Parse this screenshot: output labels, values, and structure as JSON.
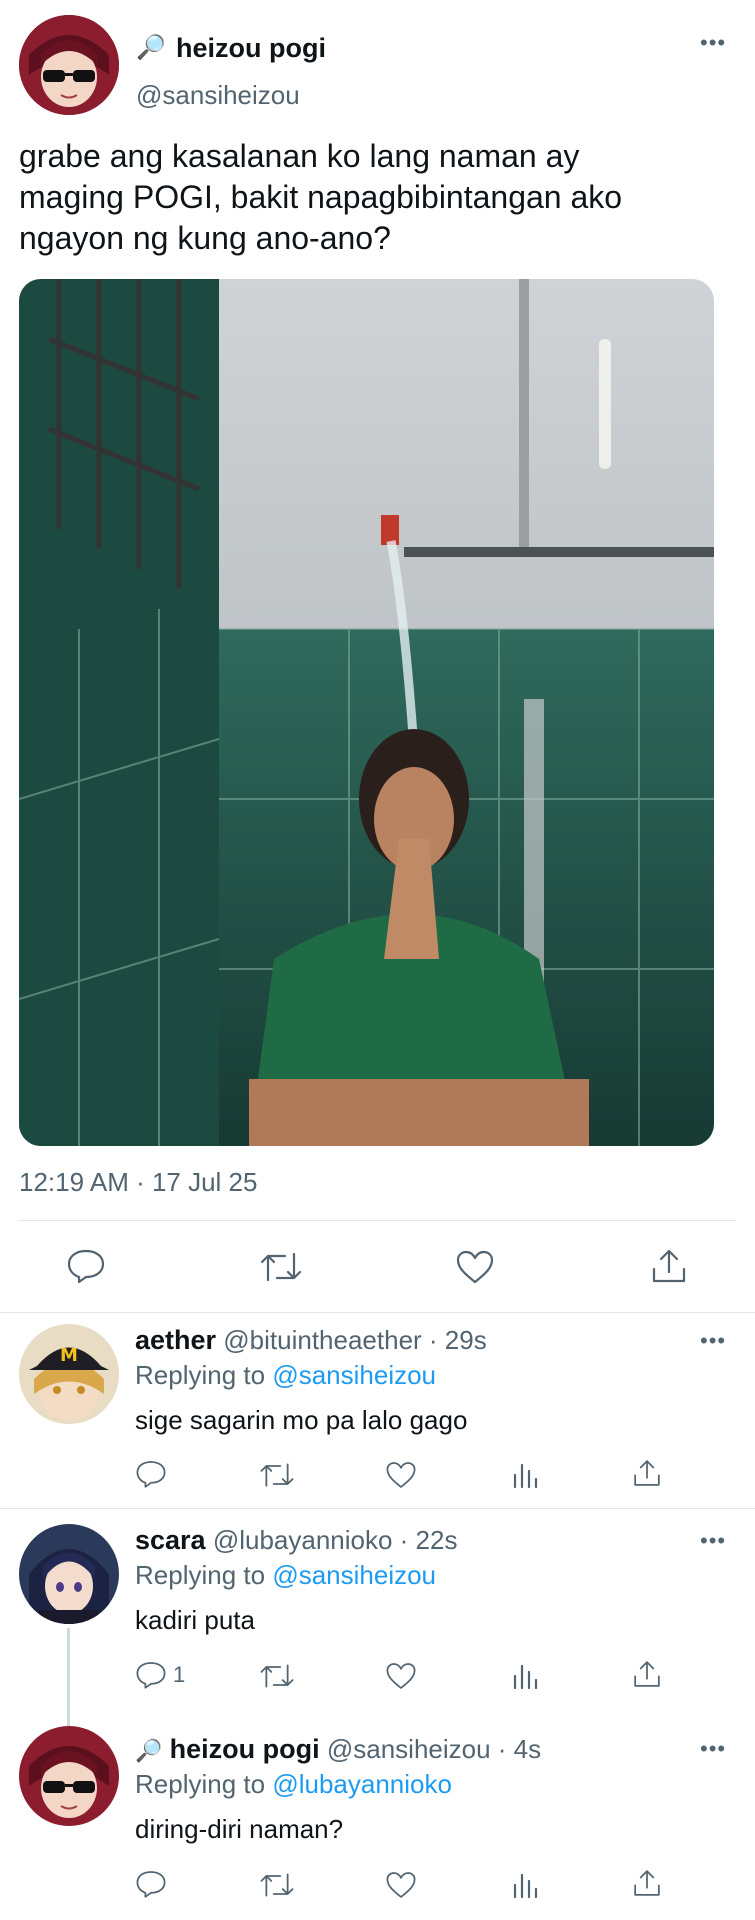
{
  "main_tweet": {
    "emoji": "🔎",
    "name": "heizou pogi",
    "handle": "@sansiheizou",
    "text_line1": "grabe ang kasalanan ko lang naman ay",
    "text_line2": "maging POGI, bakit napagbibintangan ako",
    "text_line3": "ngayon ng kung ano-ano?",
    "timestamp": "12:19 AM · 17 Jul 25",
    "more_label": "•••"
  },
  "replies": [
    {
      "name": "aether",
      "handle_time": "@bituintheaether · 29s",
      "replying_prefix": "Replying to",
      "replying_to": "@sansiheizou",
      "text": "sige sagarin mo pa lalo gago",
      "reply_count": ""
    },
    {
      "name": "scara",
      "handle_time": "@lubayannioko · 22s",
      "replying_prefix": "Replying to",
      "replying_to": "@sansiheizou",
      "text": "kadiri puta",
      "reply_count": "1"
    },
    {
      "emoji": "🔎",
      "name": "heizou pogi",
      "handle_time": "@sansiheizou · 4s",
      "replying_prefix": "Replying to",
      "replying_to": "@lubayannioko",
      "text": "diring-diri naman?",
      "reply_count": ""
    }
  ],
  "colors": {
    "accent": "#1d9bf0",
    "text": "#0f1419",
    "muted": "#536471",
    "divider": "#e3e7ea"
  },
  "icons": [
    "reply-icon",
    "retweet-icon",
    "like-icon",
    "analytics-icon",
    "share-icon",
    "more-icon",
    "magnifier-icon"
  ]
}
